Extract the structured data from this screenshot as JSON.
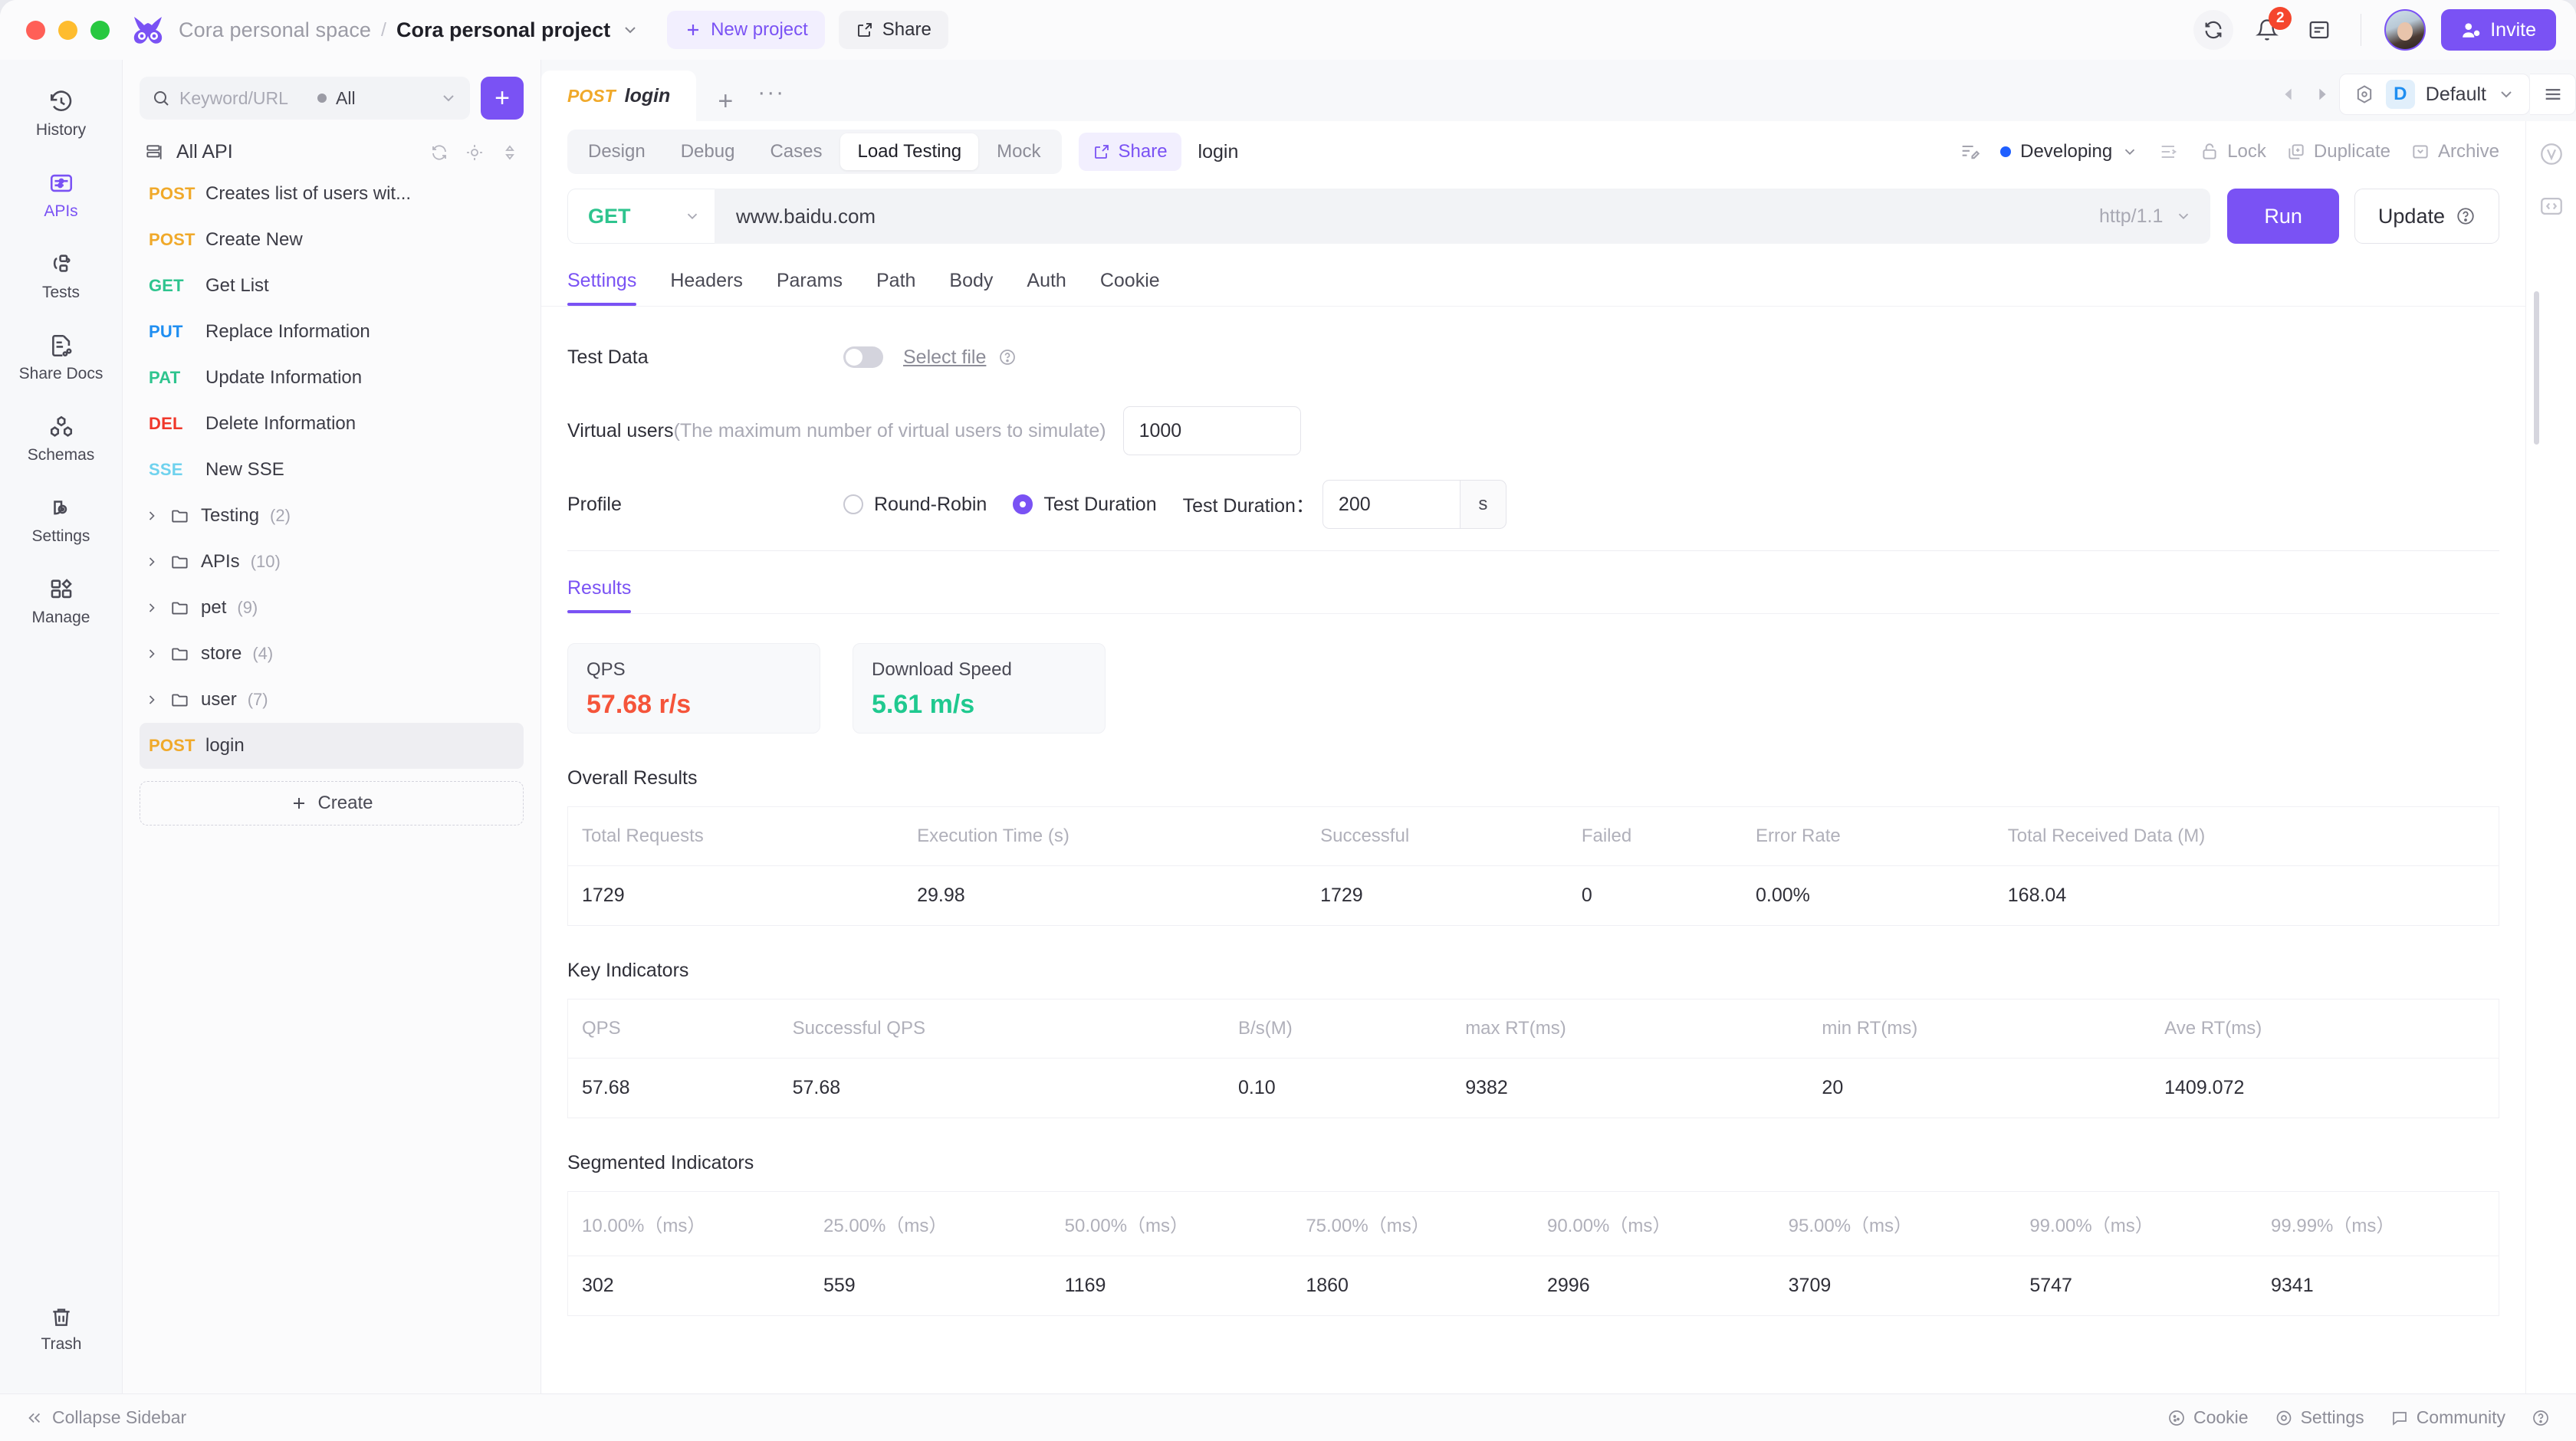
{
  "titlebar": {
    "space": "Cora personal space",
    "separator": "/",
    "project": "Cora personal project",
    "new_project": "New project",
    "share": "Share",
    "notification_count": "2",
    "invite": "Invite"
  },
  "rail": {
    "items": [
      {
        "label": "History",
        "icon": "history-icon",
        "active": false
      },
      {
        "label": "APIs",
        "icon": "apis-icon",
        "active": true
      },
      {
        "label": "Tests",
        "icon": "tests-icon",
        "active": false
      },
      {
        "label": "Share Docs",
        "icon": "share-docs-icon",
        "active": false
      },
      {
        "label": "Schemas",
        "icon": "schemas-icon",
        "active": false
      },
      {
        "label": "Settings",
        "icon": "settings-icon",
        "active": false
      },
      {
        "label": "Manage",
        "icon": "manage-icon",
        "active": false
      }
    ],
    "trash": "Trash"
  },
  "apilist": {
    "search_placeholder": "Keyword/URL",
    "filter_label": "All",
    "all_api_label": "All API",
    "create_label": "Create",
    "items": [
      {
        "method": "POST",
        "cls": "m-post",
        "name": "Creates list of users wit..."
      },
      {
        "method": "POST",
        "cls": "m-post",
        "name": "Create New"
      },
      {
        "method": "GET",
        "cls": "m-get",
        "name": "Get List"
      },
      {
        "method": "PUT",
        "cls": "m-put",
        "name": "Replace Information"
      },
      {
        "method": "PAT",
        "cls": "m-pat",
        "name": "Update Information"
      },
      {
        "method": "DEL",
        "cls": "m-del",
        "name": "Delete Information"
      },
      {
        "method": "SSE",
        "cls": "m-sse",
        "name": "New SSE"
      }
    ],
    "folders": [
      {
        "name": "Testing",
        "count": "(2)"
      },
      {
        "name": "APIs",
        "count": "(10)"
      },
      {
        "name": "pet",
        "count": "(9)"
      },
      {
        "name": "store",
        "count": "(4)"
      },
      {
        "name": "user",
        "count": "(7)"
      }
    ],
    "selected": {
      "method": "POST",
      "cls": "m-post",
      "name": "login"
    }
  },
  "doctab": {
    "method": "POST",
    "name": "login"
  },
  "env": {
    "badge": "D",
    "name": "Default"
  },
  "toolbar": {
    "tabs": [
      {
        "label": "Design",
        "active": false
      },
      {
        "label": "Debug",
        "active": false
      },
      {
        "label": "Cases",
        "active": false
      },
      {
        "label": "Load Testing",
        "active": true
      },
      {
        "label": "Mock",
        "active": false
      }
    ],
    "share_label": "Share",
    "doc_name": "login",
    "status": "Developing",
    "status_color": "#1f5fff",
    "lock": "Lock",
    "duplicate": "Duplicate",
    "archive": "Archive"
  },
  "urlbar": {
    "method": "GET",
    "url": "www.baidu.com",
    "protocol": "http/1.1",
    "run": "Run",
    "update": "Update"
  },
  "subtabs": [
    {
      "label": "Settings",
      "active": true
    },
    {
      "label": "Headers",
      "active": false
    },
    {
      "label": "Params",
      "active": false
    },
    {
      "label": "Path",
      "active": false
    },
    {
      "label": "Body",
      "active": false
    },
    {
      "label": "Auth",
      "active": false
    },
    {
      "label": "Cookie",
      "active": false
    }
  ],
  "settings": {
    "test_data_label": "Test Data",
    "select_file": "Select file",
    "virtual_users_label": "Virtual users",
    "virtual_users_hint": "(The maximum number of virtual users to simulate)",
    "virtual_users_value": "1000",
    "profile_label": "Profile",
    "round_robin": "Round-Robin",
    "test_duration_radio": "Test Duration",
    "test_duration_label": "Test Duration：",
    "test_duration_value": "200",
    "test_duration_unit": "s"
  },
  "results": {
    "tab_label": "Results",
    "cards": [
      {
        "title": "QPS",
        "value": "57.68 r/s",
        "color_class": "red"
      },
      {
        "title": "Download Speed",
        "value": "5.61 m/s",
        "color_class": "green"
      }
    ],
    "overall": {
      "title": "Overall Results",
      "headers": [
        "Total Requests",
        "Execution Time (s)",
        "Successful",
        "Failed",
        "Error Rate",
        "Total Received Data (M)"
      ],
      "row": [
        "1729",
        "29.98",
        "1729",
        "0",
        "0.00%",
        "168.04"
      ]
    },
    "key_indicators": {
      "title": "Key Indicators",
      "headers": [
        "QPS",
        "Successful QPS",
        "B/s(M)",
        "max RT(ms)",
        "min RT(ms)",
        "Ave RT(ms)"
      ],
      "row": [
        "57.68",
        "57.68",
        "0.10",
        "9382",
        "20",
        "1409.072"
      ]
    },
    "segmented": {
      "title": "Segmented Indicators",
      "headers": [
        "10.00%（ms）",
        "25.00%（ms）",
        "50.00%（ms）",
        "75.00%（ms）",
        "90.00%（ms）",
        "95.00%（ms）",
        "99.00%（ms）",
        "99.99%（ms）"
      ],
      "row": [
        "302",
        "559",
        "1169",
        "1860",
        "2996",
        "3709",
        "5747",
        "9341"
      ]
    }
  },
  "statusbar": {
    "collapse": "Collapse Sidebar",
    "cookie": "Cookie",
    "settings": "Settings",
    "community": "Community"
  },
  "colors": {
    "accent": "#7a52f4",
    "post": "#f0a92a",
    "get": "#2ec48e",
    "put": "#1f8ef1",
    "del": "#f0372a",
    "sse": "#6fd2ee",
    "qps": "#f5543a",
    "download": "#1fc98f",
    "status": "#1f5fff"
  }
}
